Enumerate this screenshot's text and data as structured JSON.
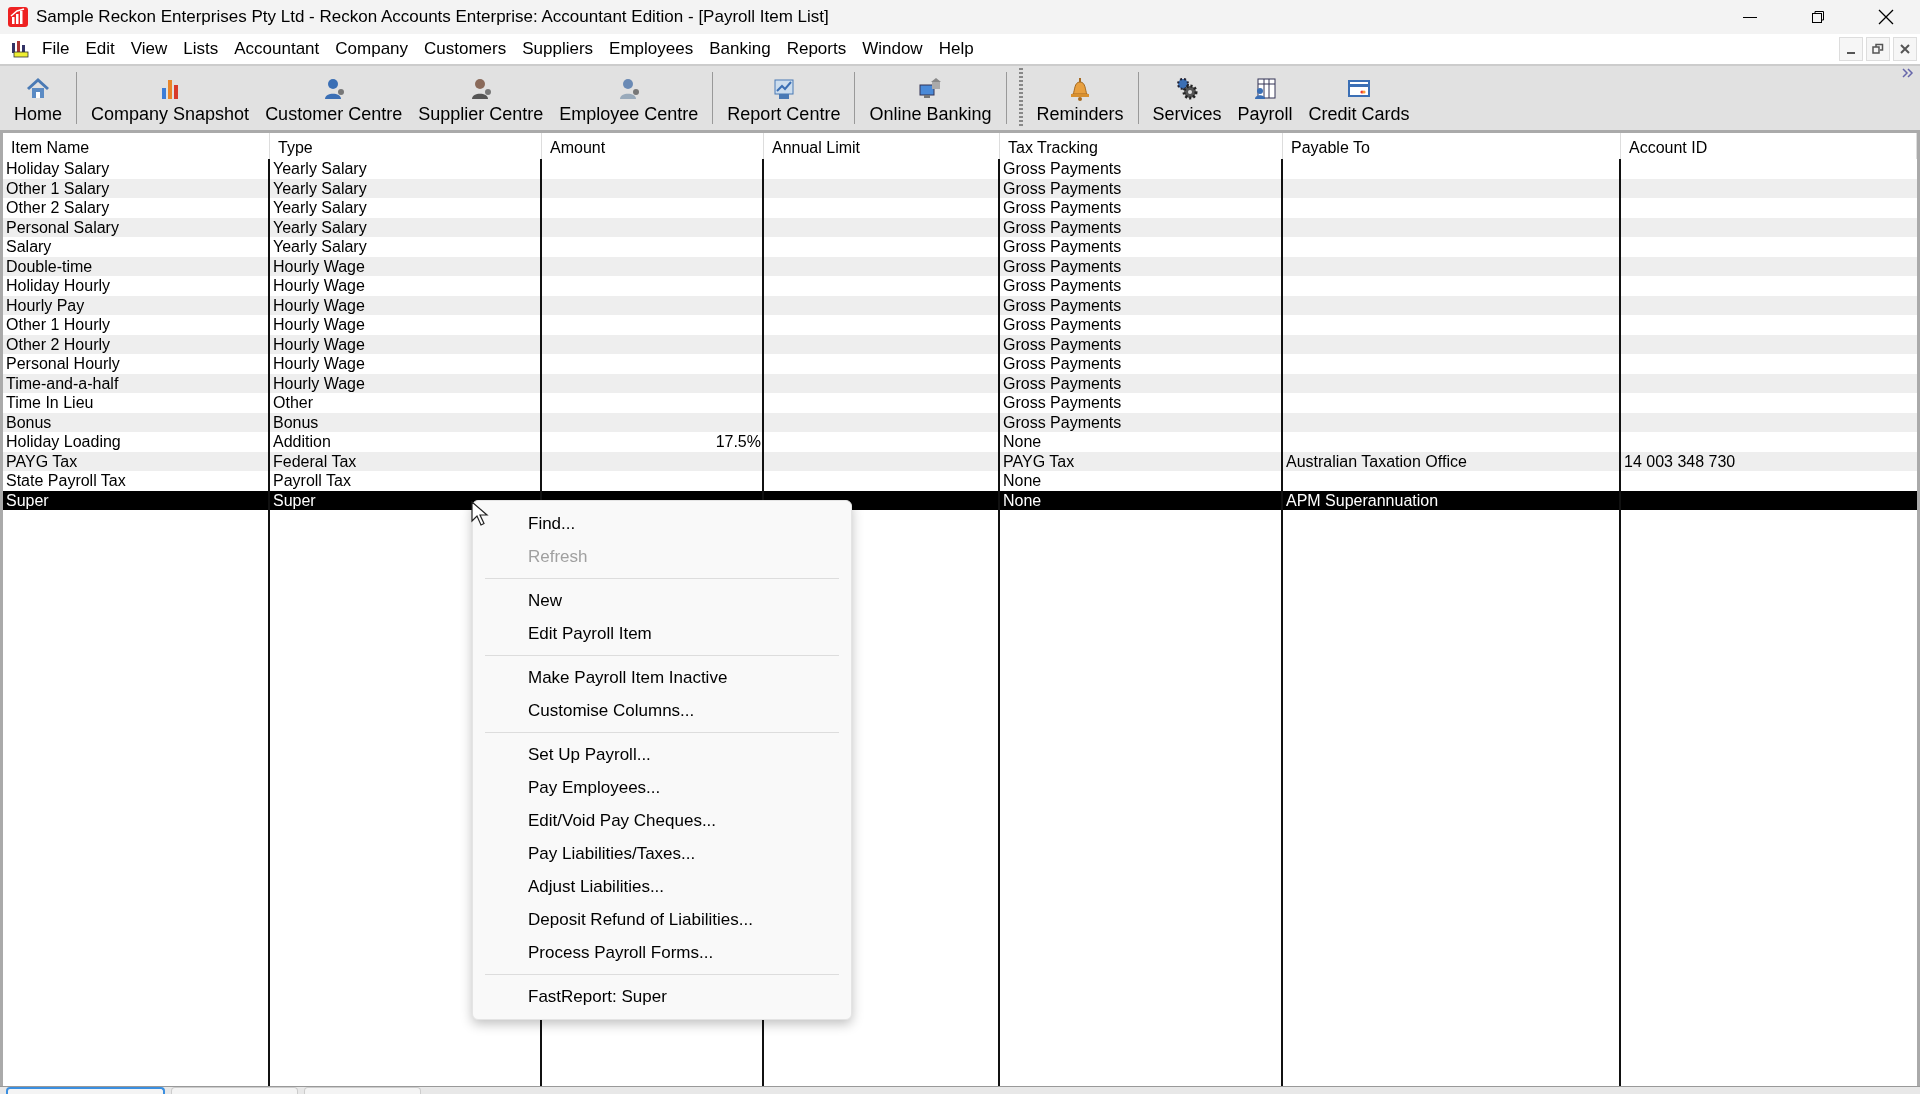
{
  "window": {
    "title": "Sample Reckon Enterprises Pty Ltd - Reckon Accounts Enterprise: Accountant Edition - [Payroll Item List]"
  },
  "menu_bar": [
    "File",
    "Edit",
    "View",
    "Lists",
    "Accountant",
    "Company",
    "Customers",
    "Suppliers",
    "Employees",
    "Banking",
    "Reports",
    "Window",
    "Help"
  ],
  "toolbar": [
    {
      "label": "Home"
    },
    {
      "label": "Company Snapshot",
      "separator_before": true
    },
    {
      "label": "Customer Centre"
    },
    {
      "label": "Supplier Centre"
    },
    {
      "label": "Employee Centre"
    },
    {
      "label": "Report Centre",
      "separator_before": true
    },
    {
      "label": "Online Banking",
      "separator_before": true
    },
    {
      "label": "Reminders",
      "separator_before": true
    },
    {
      "label": "Services",
      "separator_before": true
    },
    {
      "label": "Payroll"
    },
    {
      "label": "Credit Cards"
    }
  ],
  "table": {
    "columns": [
      "Item Name",
      "Type",
      "Amount",
      "Annual Limit",
      "Tax Tracking",
      "Payable To",
      "Account ID"
    ],
    "rows": [
      {
        "cells": [
          "Holiday Salary",
          "Yearly Salary",
          "",
          "",
          "Gross Payments",
          "",
          ""
        ],
        "selected": false
      },
      {
        "cells": [
          "Other 1 Salary",
          "Yearly Salary",
          "",
          "",
          "Gross Payments",
          "",
          ""
        ],
        "selected": false
      },
      {
        "cells": [
          "Other 2 Salary",
          "Yearly Salary",
          "",
          "",
          "Gross Payments",
          "",
          ""
        ],
        "selected": false
      },
      {
        "cells": [
          "Personal Salary",
          "Yearly Salary",
          "",
          "",
          "Gross Payments",
          "",
          ""
        ],
        "selected": false
      },
      {
        "cells": [
          "Salary",
          "Yearly Salary",
          "",
          "",
          "Gross Payments",
          "",
          ""
        ],
        "selected": false
      },
      {
        "cells": [
          "Double-time",
          "Hourly Wage",
          "",
          "",
          "Gross Payments",
          "",
          ""
        ],
        "selected": false
      },
      {
        "cells": [
          "Holiday Hourly",
          "Hourly Wage",
          "",
          "",
          "Gross Payments",
          "",
          ""
        ],
        "selected": false
      },
      {
        "cells": [
          "Hourly Pay",
          "Hourly Wage",
          "",
          "",
          "Gross Payments",
          "",
          ""
        ],
        "selected": false
      },
      {
        "cells": [
          "Other 1 Hourly",
          "Hourly Wage",
          "",
          "",
          "Gross Payments",
          "",
          ""
        ],
        "selected": false
      },
      {
        "cells": [
          "Other 2 Hourly",
          "Hourly Wage",
          "",
          "",
          "Gross Payments",
          "",
          ""
        ],
        "selected": false
      },
      {
        "cells": [
          "Personal Hourly",
          "Hourly Wage",
          "",
          "",
          "Gross Payments",
          "",
          ""
        ],
        "selected": false
      },
      {
        "cells": [
          "Time-and-a-half",
          "Hourly Wage",
          "",
          "",
          "Gross Payments",
          "",
          ""
        ],
        "selected": false
      },
      {
        "cells": [
          "Time In Lieu",
          "Other",
          "",
          "",
          "Gross Payments",
          "",
          ""
        ],
        "selected": false
      },
      {
        "cells": [
          "Bonus",
          "Bonus",
          "",
          "",
          "Gross Payments",
          "",
          ""
        ],
        "selected": false
      },
      {
        "cells": [
          "Holiday Loading",
          "Addition",
          "17.5%",
          "",
          "None",
          "",
          ""
        ],
        "selected": false
      },
      {
        "cells": [
          "PAYG Tax",
          "Federal Tax",
          "",
          "",
          "PAYG Tax",
          "Australian Taxation Office",
          "14 003 348 730"
        ],
        "selected": false
      },
      {
        "cells": [
          "State Payroll Tax",
          "Payroll Tax",
          "",
          "",
          "None",
          "",
          ""
        ],
        "selected": false
      },
      {
        "cells": [
          "Super",
          "Super",
          "",
          "",
          "None",
          "APM Superannuation",
          ""
        ],
        "selected": true
      }
    ]
  },
  "window_tabs": [
    {
      "selected": true
    },
    {
      "selected": false
    },
    {
      "selected": false
    }
  ],
  "context_menu": [
    [
      {
        "label": "Find...",
        "disabled": false
      },
      {
        "label": "Refresh",
        "disabled": true
      }
    ],
    [
      {
        "label": "New",
        "disabled": false
      },
      {
        "label": "Edit Payroll Item",
        "disabled": false
      }
    ],
    [
      {
        "label": "Make Payroll Item Inactive",
        "disabled": false
      },
      {
        "label": "Customise Columns...",
        "disabled": false
      }
    ],
    [
      {
        "label": "Set Up Payroll...",
        "disabled": false
      },
      {
        "label": "Pay Employees...",
        "disabled": false
      },
      {
        "label": "Edit/Void Pay Cheques...",
        "disabled": false
      },
      {
        "label": "Pay Liabilities/Taxes...",
        "disabled": false
      },
      {
        "label": "Adjust Liabilities...",
        "disabled": false
      },
      {
        "label": "Deposit Refund of Liabilities...",
        "disabled": false
      },
      {
        "label": "Process Payroll Forms...",
        "disabled": false
      }
    ],
    [
      {
        "label": "FastReport: Super",
        "disabled": false
      }
    ]
  ]
}
